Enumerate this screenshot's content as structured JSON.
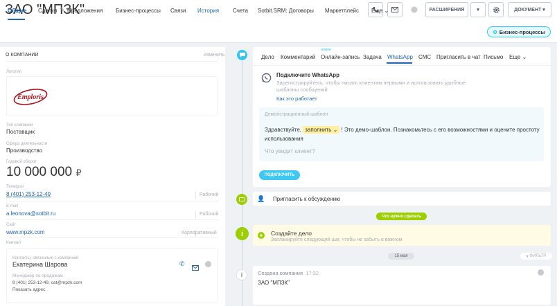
{
  "header": {
    "title": "ЗАО \"МПЗК\"",
    "extensions_label": "РАСШИРЕНИЯ",
    "document_label": "ДОКУМЕНТ"
  },
  "tabs": [
    "Общие",
    "Сделки",
    "Предложения",
    "Бизнес-процессы",
    "Связи",
    "История",
    "Счета",
    "Sotbit.SRM: Договоры",
    "Маркетплейс",
    "Еще"
  ],
  "business_processes_button": "Бизнес-процессы",
  "about": {
    "heading": "О КОМПАНИИ",
    "edit": "изменить",
    "logo_label": "Логотип",
    "logo_text": "Emploris",
    "type_label": "Тип компании",
    "type_value": "Поставщик",
    "industry_label": "Сфера деятельности",
    "industry_value": "Производство",
    "revenue_label": "Годовой оборот",
    "revenue_value": "10 000 000",
    "revenue_currency": "₽",
    "phone_label": "Телефон",
    "phone_value": "8 (401) 253-12-49",
    "phone_kind": "Рабочий",
    "email_label": "E-mail",
    "email_value": "a.leonova@sotbit.ru",
    "email_kind": "Рабочий",
    "site_label": "Сайт",
    "site_value": "www.mpzk.com",
    "site_kind": "Корпоративный",
    "contact_label": "Контакт",
    "contact": {
      "related_label": "Контакты, связанные с компанией",
      "name": "Екатерина Шарова",
      "position": "Менеджер по продажам",
      "details": "8 (401) 253-12-49, cat@mpzk.com",
      "show_address": "Показать адрес"
    }
  },
  "editor": {
    "tabs": [
      "Дело",
      "Комментарий",
      "Онлайн-запись",
      "Задача",
      "WhatsApp",
      "СМС",
      "Пригласить в чат",
      "Письмо",
      "Еще"
    ],
    "new_badge": "новое",
    "wa_heading": "Подключите WhatsApp",
    "wa_description": "Зарегистрируйтесь, чтобы писать клиентам первыми и использовать удобные шаблоны сообщений",
    "wa_link": "Как это работает",
    "demo_label": "Демонстрационный шаблон",
    "demo_before": "Здравствуйте,",
    "demo_fill": "заполнить",
    "demo_after": "! Это демо-шаблон. Познакомьтесь с его возможностями и оцените простоту использования",
    "demo_question": "Что увидит клиент?",
    "connect_button": "ПОДКЛЮЧИТЬ"
  },
  "timeline": {
    "invite": "Пригласить к обсуждению",
    "todo_pill": "Что нужно сделать",
    "create_task_title": "Создайте дело",
    "create_task_hint": "Запланируйте следующий шаг, чтобы не забыть о важном",
    "date_pill": "15 мая",
    "filter_label": "Фильтр",
    "event_title": "Создана компания",
    "event_time": "17:32",
    "event_body": "ЗАО \"МПЗК\""
  },
  "colors": {
    "accent_blue": "#2067b0",
    "light_blue": "#2fc6f6",
    "green": "#9dcf00",
    "warning_bg": "#fffbe4"
  }
}
